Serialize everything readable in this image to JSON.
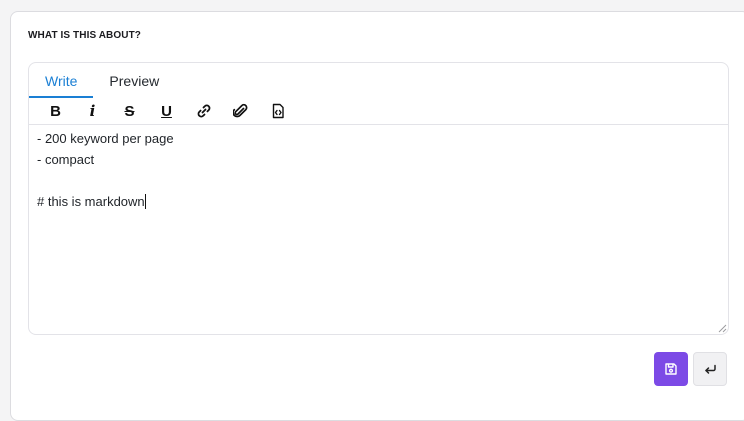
{
  "section": {
    "title": "WHAT IS THIS ABOUT?"
  },
  "tabs": [
    {
      "label": "Write",
      "active": true
    },
    {
      "label": "Preview",
      "active": false
    }
  ],
  "toolbar": {
    "bold": "B",
    "italic": "i",
    "strikethrough": "S",
    "underline": "U",
    "icons": [
      "link-icon",
      "attachment-icon",
      "code-file-icon"
    ]
  },
  "editor": {
    "lines": [
      "- 200 keyword per page",
      "- compact",
      "",
      "# this is markdown"
    ]
  },
  "actions": {
    "save_icon": "save-icon",
    "cancel_icon": "return-icon"
  },
  "colors": {
    "accent": "#1a7fd4",
    "save_button": "#7c4ae6"
  }
}
